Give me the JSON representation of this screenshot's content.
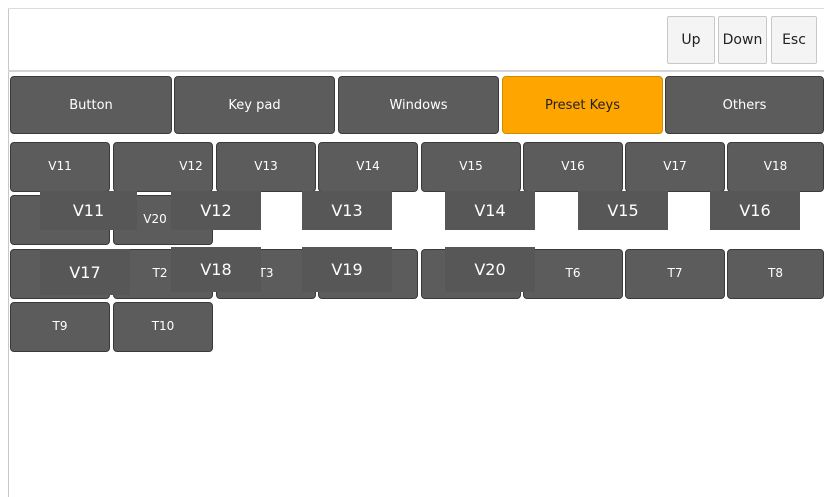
{
  "toolbar": {
    "up": "Up",
    "down": "Down",
    "esc": "Esc"
  },
  "tabs": [
    "Button",
    "Key pad",
    "Windows",
    "Preset Keys",
    "Others"
  ],
  "active_tab": "Preset Keys",
  "grid": {
    "row1": [
      "V11",
      "V12",
      "V13",
      "V14",
      "V15",
      "V16",
      "V17",
      "V18"
    ],
    "row2": [
      "V20"
    ],
    "row3": [
      "T2",
      "T3",
      "T6",
      "T7",
      "T8"
    ],
    "row4": [
      "T9",
      "T10"
    ]
  },
  "overlays": {
    "row1": [
      "V11",
      "V12",
      "V13",
      "V14",
      "V15",
      "V16"
    ],
    "row2": [
      "V17",
      "V18",
      "V19",
      "V20"
    ]
  },
  "colors": {
    "active_tab": "#ffa500",
    "key": "#5c5c5c",
    "overlay": "#575757"
  }
}
